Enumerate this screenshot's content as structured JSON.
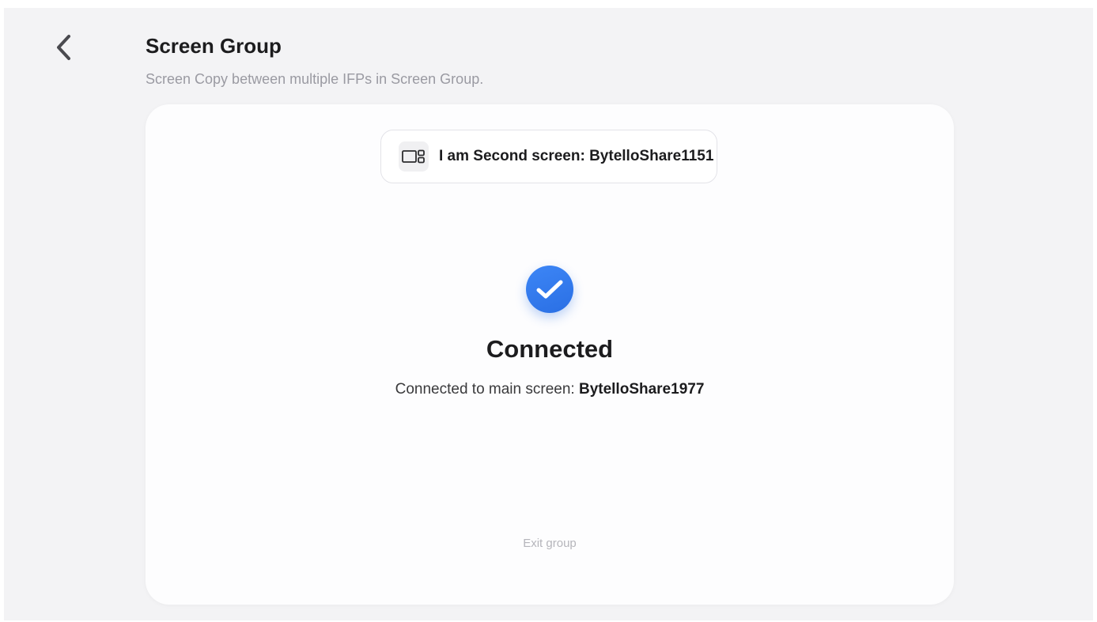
{
  "header": {
    "back_icon": "chevron-left-icon",
    "title": "Screen Group",
    "subtitle": "Screen Copy between multiple IFPs in Screen Group."
  },
  "role": {
    "icon": "screen-layout-icon",
    "label": "I am Second screen: BytelloShare1151"
  },
  "status": {
    "icon": "check-circle-icon",
    "icon_color": "#3478F0",
    "title": "Connected",
    "detail_prefix": "Connected to main screen: ",
    "main_screen_name": "BytelloShare1977"
  },
  "actions": {
    "exit_label": "Exit group"
  }
}
